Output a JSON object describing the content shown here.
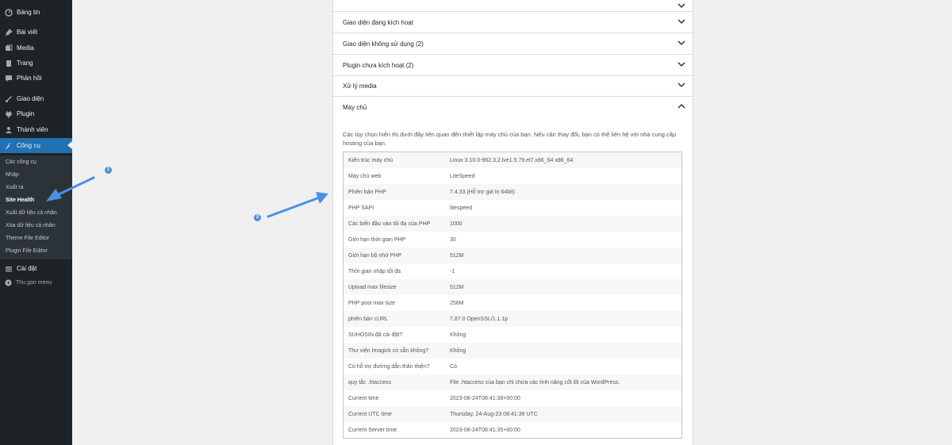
{
  "sidebar": {
    "menu": [
      {
        "label": "Bảng tin",
        "icon": "dashboard-icon"
      },
      {
        "label": "Bài viết",
        "icon": "pin-icon"
      },
      {
        "label": "Media",
        "icon": "media-icon"
      },
      {
        "label": "Trang",
        "icon": "page-icon"
      },
      {
        "label": "Phản hồi",
        "icon": "comment-icon"
      },
      {
        "label": "Giao diện",
        "icon": "brush-icon"
      },
      {
        "label": "Plugin",
        "icon": "plugin-icon"
      },
      {
        "label": "Thành viên",
        "icon": "user-icon"
      },
      {
        "label": "Công cụ",
        "icon": "wrench-icon"
      },
      {
        "label": "Cài đặt",
        "icon": "settings-icon"
      }
    ],
    "submenu": [
      "Các công cụ",
      "Nhập",
      "Xuất ra",
      "Site Health",
      "Xuất dữ liệu cá nhân",
      "Xóa dữ liệu cá nhân",
      "Theme File Editor",
      "Plugin File Editor"
    ],
    "collapse_label": "Thu gọn menu"
  },
  "accordions": [
    "Giao diện đang kích hoạt",
    "Giao diện không sử dụng (2)",
    "Plugin chưa kích hoạt (2)",
    "Xử lý media",
    "Máy chủ"
  ],
  "server": {
    "description": "Các tùy chọn hiển thị dưới đây liên quan đến thiết lập máy chủ của bạn. Nếu cần thay đổi, bạn có thể liên hệ với nhà cung cấp hosting của bạn.",
    "rows": [
      {
        "key": "Kiến trúc máy chủ",
        "value": "Linux 3.10.0-962.3.2.lve1.5.79.el7.x86_64 x86_64"
      },
      {
        "key": "Máy chủ web",
        "value": "LiteSpeed"
      },
      {
        "key": "Phiên bản PHP",
        "value": "7.4.33 (Hỗ trợ giá trị 64bit)"
      },
      {
        "key": "PHP SAPI",
        "value": "litespeed"
      },
      {
        "key": "Các biến đầu vào tối đa của PHP",
        "value": "1000"
      },
      {
        "key": "Giới hạn thời gian PHP",
        "value": "30"
      },
      {
        "key": "Giới hạn bộ nhớ PHP",
        "value": "512M"
      },
      {
        "key": "Thời gian nhập tối đa",
        "value": "-1"
      },
      {
        "key": "Upload max filesize",
        "value": "512M"
      },
      {
        "key": "PHP post max size",
        "value": "256M"
      },
      {
        "key": "phiên bản cURL",
        "value": "7.87.0 OpenSSL/1.1.1p"
      },
      {
        "key": "SUHOSIN đã cài đặt?",
        "value": "Không"
      },
      {
        "key": "Thư viện Imagick có sẵn không?",
        "value": "Không"
      },
      {
        "key": "Có hỗ trợ đường dẫn thân thiện?",
        "value": "Có"
      },
      {
        "key": "quy tắc .htaccess",
        "value": "File .htaccess của bạn chỉ chứa các tính năng cốt lõi của WordPress."
      },
      {
        "key": "Current time",
        "value": "2023-08-24T08:41:38+00:00"
      },
      {
        "key": "Current UTC time",
        "value": "Thursday, 24-Aug-23 08:41:38 UTC"
      },
      {
        "key": "Current Server time",
        "value": "2023-08-24T08:41:35+00:00"
      }
    ]
  },
  "annotations": {
    "badge1": "1",
    "badge2": "2"
  },
  "colors": {
    "sidebar_bg": "#1d2327",
    "active": "#2271b1",
    "arrow": "#4a90e2"
  }
}
